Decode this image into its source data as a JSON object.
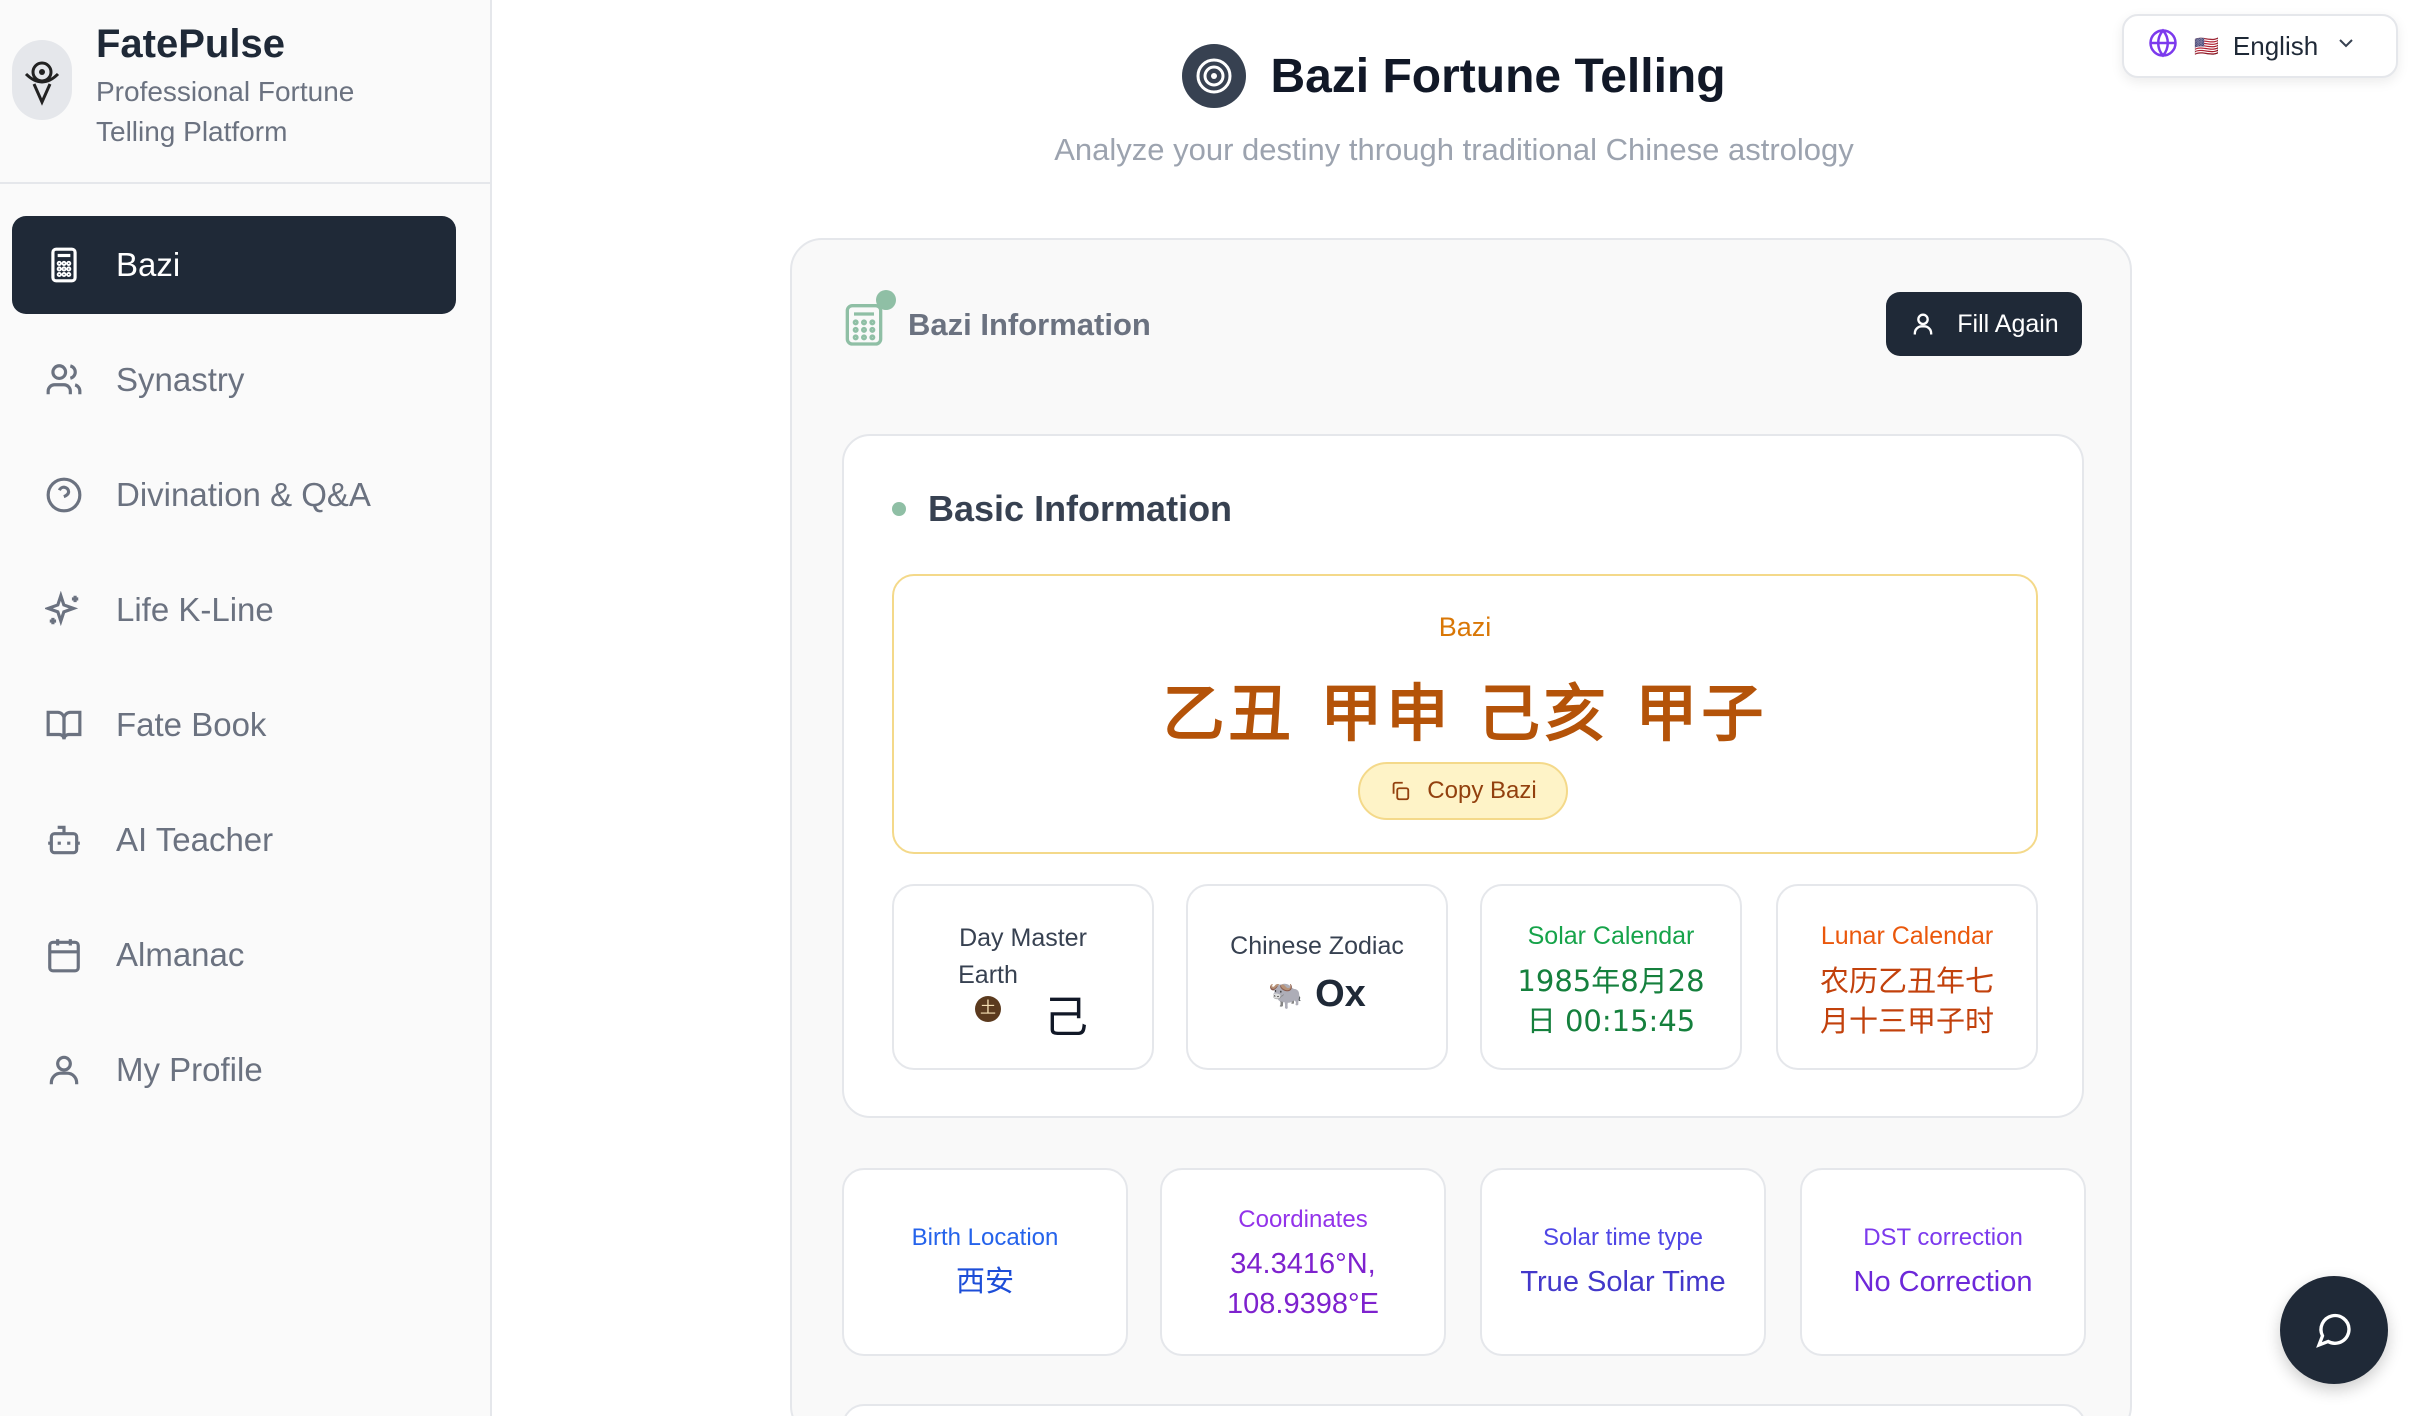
{
  "brand": {
    "name": "FatePulse",
    "tagline": "Professional Fortune Telling Platform"
  },
  "nav": {
    "items": [
      {
        "label": "Bazi",
        "icon": "calculator-icon",
        "active": true
      },
      {
        "label": "Synastry",
        "icon": "users-icon"
      },
      {
        "label": "Divination & Q&A",
        "icon": "help-circle-icon"
      },
      {
        "label": "Life K-Line",
        "icon": "sparkles-icon"
      },
      {
        "label": "Fate Book",
        "icon": "book-open-icon"
      },
      {
        "label": "AI Teacher",
        "icon": "bot-icon"
      },
      {
        "label": "Almanac",
        "icon": "calendar-icon"
      },
      {
        "label": "My Profile",
        "icon": "user-icon"
      }
    ]
  },
  "header": {
    "title": "Bazi Fortune Telling",
    "subtitle": "Analyze your destiny through traditional Chinese astrology"
  },
  "language": {
    "label": "English",
    "flag": "🇺🇸"
  },
  "card": {
    "title": "Bazi Information",
    "fill_again": "Fill Again",
    "basic_title": "Basic Information",
    "bazi_label": "Bazi",
    "bazi_value": "乙丑 甲申 己亥 甲子",
    "copy_label": "Copy Bazi",
    "day_master": {
      "label": "Day Master",
      "element": "Earth",
      "element_glyph": "土",
      "stem": "己"
    },
    "zodiac": {
      "label": "Chinese Zodiac",
      "icon": "🐃",
      "value": "Ox"
    },
    "solar": {
      "label": "Solar Calendar",
      "value": "1985年8月28日 00:15:45"
    },
    "lunar": {
      "label": "Lunar Calendar",
      "value": "农历乙丑年七月十三甲子时"
    },
    "location": {
      "label": "Birth Location",
      "value": "西安"
    },
    "coordinates": {
      "label": "Coordinates",
      "value": "34.3416°N, 108.9398°E"
    },
    "solar_time": {
      "label": "Solar time type",
      "value": "True Solar Time"
    },
    "dst": {
      "label": "DST correction",
      "value": "No Correction"
    }
  },
  "colors": {
    "accent_dark": "#1f2937",
    "bazi_gold": "#b45309",
    "sidebar_bg": "#fafafa"
  }
}
